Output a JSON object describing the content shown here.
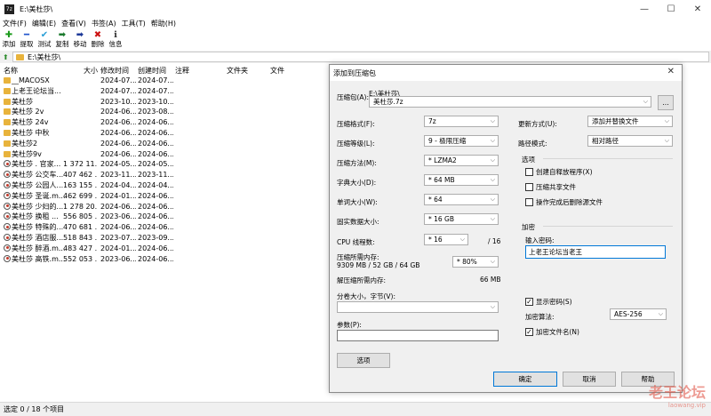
{
  "window": {
    "title": "E:\\美杜莎\\",
    "icon_text": "7z"
  },
  "menu": [
    "文件(F)",
    "编辑(E)",
    "查看(V)",
    "书签(A)",
    "工具(T)",
    "帮助(H)"
  ],
  "toolbar": [
    {
      "label": "添加",
      "icon": "plus-icon",
      "color": "#1a9a1a"
    },
    {
      "label": "提取",
      "icon": "minus-icon",
      "color": "#2255cc"
    },
    {
      "label": "测试",
      "icon": "check-icon",
      "color": "#2a9fd6"
    },
    {
      "label": "复制",
      "icon": "arrow-right-icon",
      "color": "#1b7a2e"
    },
    {
      "label": "移动",
      "icon": "arrow-right-icon",
      "color": "#1e3a99"
    },
    {
      "label": "删除",
      "icon": "x-icon",
      "color": "#cc1111"
    },
    {
      "label": "信息",
      "icon": "info-icon",
      "color": "#333333"
    }
  ],
  "address": "E:\\美杜莎\\",
  "columns": [
    "名称",
    "大小",
    "修改时间",
    "创建时间",
    "注释",
    "文件夹",
    "文件"
  ],
  "rows": [
    {
      "name": "__MACOSX",
      "size": "",
      "modified": "2024-07...",
      "created": "2024-07...",
      "type": "folder"
    },
    {
      "name": "上老王论坛当...",
      "size": "",
      "modified": "2024-07...",
      "created": "2024-07...",
      "type": "folder"
    },
    {
      "name": "美杜莎",
      "size": "",
      "modified": "2023-10...",
      "created": "2023-10...",
      "type": "folder"
    },
    {
      "name": "美杜莎 2v",
      "size": "",
      "modified": "2024-06...",
      "created": "2023-08...",
      "type": "folder"
    },
    {
      "name": "美杜莎 24v",
      "size": "",
      "modified": "2024-06...",
      "created": "2024-06...",
      "type": "folder"
    },
    {
      "name": "美杜莎 中秋",
      "size": "",
      "modified": "2024-06...",
      "created": "2024-06...",
      "type": "folder"
    },
    {
      "name": "美杜莎2",
      "size": "",
      "modified": "2024-06...",
      "created": "2024-06...",
      "type": "folder"
    },
    {
      "name": "美杜莎9v",
      "size": "",
      "modified": "2024-06...",
      "created": "2024-06...",
      "type": "folder"
    },
    {
      "name": "美杜莎 . 官家...",
      "size": "1 372 11...",
      "modified": "2024-05...",
      "created": "2024-05...",
      "type": "video"
    },
    {
      "name": "美杜莎 公交车...",
      "size": "407 462 ...",
      "modified": "2023-11...",
      "created": "2023-11...",
      "type": "video"
    },
    {
      "name": "美杜莎 公园人...",
      "size": "163 155 ...",
      "modified": "2024-04...",
      "created": "2024-04...",
      "type": "video"
    },
    {
      "name": "美杜莎 圣诞.m...",
      "size": "462 699 ...",
      "modified": "2024-01...",
      "created": "2024-06...",
      "type": "video"
    },
    {
      "name": "美杜莎 少妇的...",
      "size": "1 278 20...",
      "modified": "2024-06...",
      "created": "2024-06...",
      "type": "video"
    },
    {
      "name": "美杜莎 换租 ...",
      "size": "556 805 ...",
      "modified": "2023-06...",
      "created": "2024-06...",
      "type": "video"
    },
    {
      "name": "美杜莎 特殊的...",
      "size": "470 681 ...",
      "modified": "2024-06...",
      "created": "2024-06...",
      "type": "video"
    },
    {
      "name": "美杜莎 酒店服...",
      "size": "518 843 ...",
      "modified": "2023-07...",
      "created": "2023-09...",
      "type": "video"
    },
    {
      "name": "美杜莎 醉酒.m...",
      "size": "483 427 ...",
      "modified": "2024-01...",
      "created": "2024-06...",
      "type": "video"
    },
    {
      "name": "美杜莎 高铁.m...",
      "size": "552 053 ...",
      "modified": "2023-06...",
      "created": "2024-06...",
      "type": "video"
    }
  ],
  "status": "选定 0 / 18 个项目",
  "dialog": {
    "title": "添加到压缩包",
    "archive_label": "压缩包(A):",
    "archive_path": "E:\\美杜莎\\",
    "archive_name": "美杜莎.7z",
    "browse": "...",
    "format_label": "压缩格式(F):",
    "format": "7z",
    "level_label": "压缩等级(L):",
    "level": "9 - 极限压缩",
    "method_label": "压缩方法(M):",
    "method": "* LZMA2",
    "dict_label": "字典大小(D):",
    "dict": "* 64 MB",
    "word_label": "单词大小(W):",
    "word": "* 64",
    "solid_label": "固实数据大小:",
    "solid": "* 16 GB",
    "cpu_label": "CPU 线程数:",
    "cpu": "* 16",
    "cpu_total": "/ 16",
    "mem_label": "压缩所需内存:",
    "mem_detail": "9309 MB / 52 GB / 64 GB",
    "mem_pct": "* 80%",
    "decomp_label": "解压缩所需内存:",
    "decomp_value": "66 MB",
    "split_label": "分卷大小，字节(V):",
    "split_value": "",
    "params_label": "参数(P):",
    "params_value": "",
    "options_btn": "选项",
    "update_label": "更新方式(U):",
    "update": "添加并替换文件",
    "path_label": "路径模式:",
    "path_mode": "相对路径",
    "options_group": "选项",
    "opt_sfx": "创建自释放程序(X)",
    "opt_shared": "压缩共享文件",
    "opt_delete": "操作完成后删除源文件",
    "enc_group": "加密",
    "pwd_label": "输入密码:",
    "pwd_value": "上老王论坛当老王",
    "show_pwd": "显示密码(S)",
    "enc_method_label": "加密算法:",
    "enc_method": "AES-256",
    "enc_names": "加密文件名(N)",
    "ok": "确定",
    "cancel": "取消",
    "help": "帮助"
  },
  "watermark": {
    "main": "老王论坛",
    "sub": "laowang.vip"
  }
}
